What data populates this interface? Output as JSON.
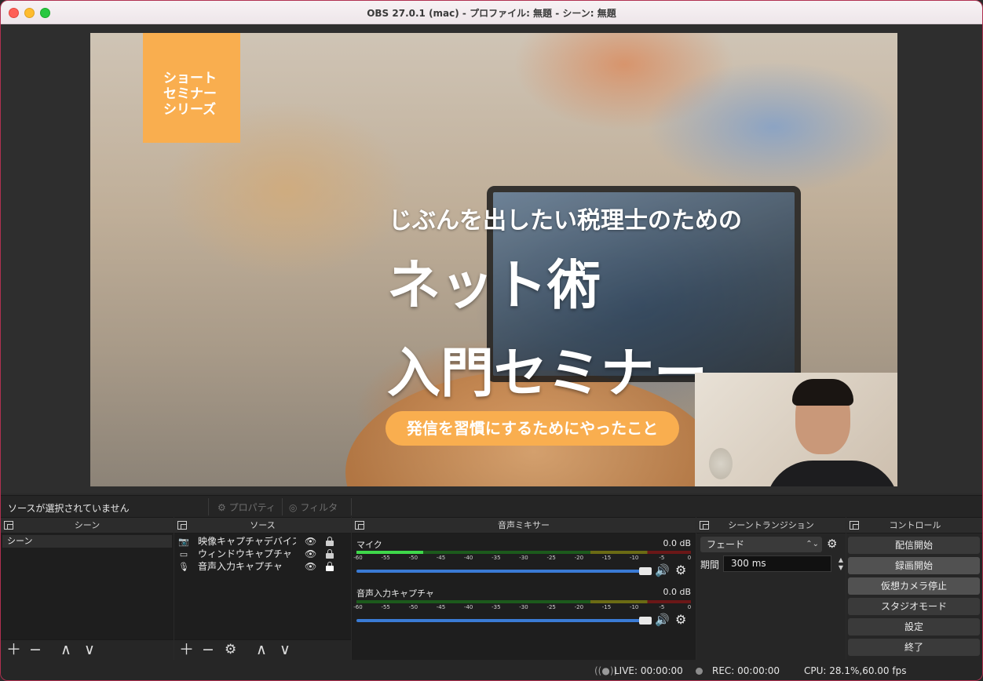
{
  "window": {
    "title": "OBS 27.0.1 (mac) - プロファイル: 無題 - シーン: 無題"
  },
  "preview": {
    "series_lines": [
      "ショート",
      "セミナー",
      "シリーズ"
    ],
    "headline": "じぶんを出したい税理士のための",
    "big_line1": "ネット術",
    "big_line2": "入門セミナー",
    "pill": "発信を習慣にするためにやったこと"
  },
  "context_bar": {
    "no_source": "ソースが選択されていません",
    "properties_label": "プロパティ",
    "filters_label": "フィルタ"
  },
  "scenes": {
    "title": "シーン",
    "items": [
      "シーン"
    ]
  },
  "sources": {
    "title": "ソース",
    "items": [
      {
        "name": "映像キャプチャデバイス",
        "icon": "camera-icon"
      },
      {
        "name": "ウィンドウキャプチャ",
        "icon": "window-icon"
      },
      {
        "name": "音声入力キャプチャ",
        "icon": "mic-icon"
      }
    ]
  },
  "mixer": {
    "title": "音声ミキサー",
    "ticks": [
      "-60",
      "-55",
      "-50",
      "-45",
      "-40",
      "-35",
      "-30",
      "-25",
      "-20",
      "-15",
      "-10",
      "-5",
      "0"
    ],
    "channels": [
      {
        "name": "マイク",
        "db": "0.0 dB",
        "level": 0.2,
        "volume": 1.0
      },
      {
        "name": "音声入力キャプチャ",
        "db": "0.0 dB",
        "level": 0.0,
        "volume": 1.0
      }
    ]
  },
  "transitions": {
    "title": "シーントランジション",
    "selected": "フェード",
    "period_label": "期間",
    "period_value": "300 ms"
  },
  "controls": {
    "title": "コントロール",
    "buttons": [
      "配信開始",
      "録画開始",
      "仮想カメラ停止",
      "スタジオモード",
      "設定",
      "終了"
    ]
  },
  "status": {
    "live": "LIVE: 00:00:00",
    "rec": "REC: 00:00:00",
    "cpu": "CPU: 28.1%,60.00 fps"
  },
  "colors": {
    "accent_orange": "#f9ae4f",
    "slider_blue": "#3a7bd5",
    "meter_green": "#3fd84a"
  }
}
